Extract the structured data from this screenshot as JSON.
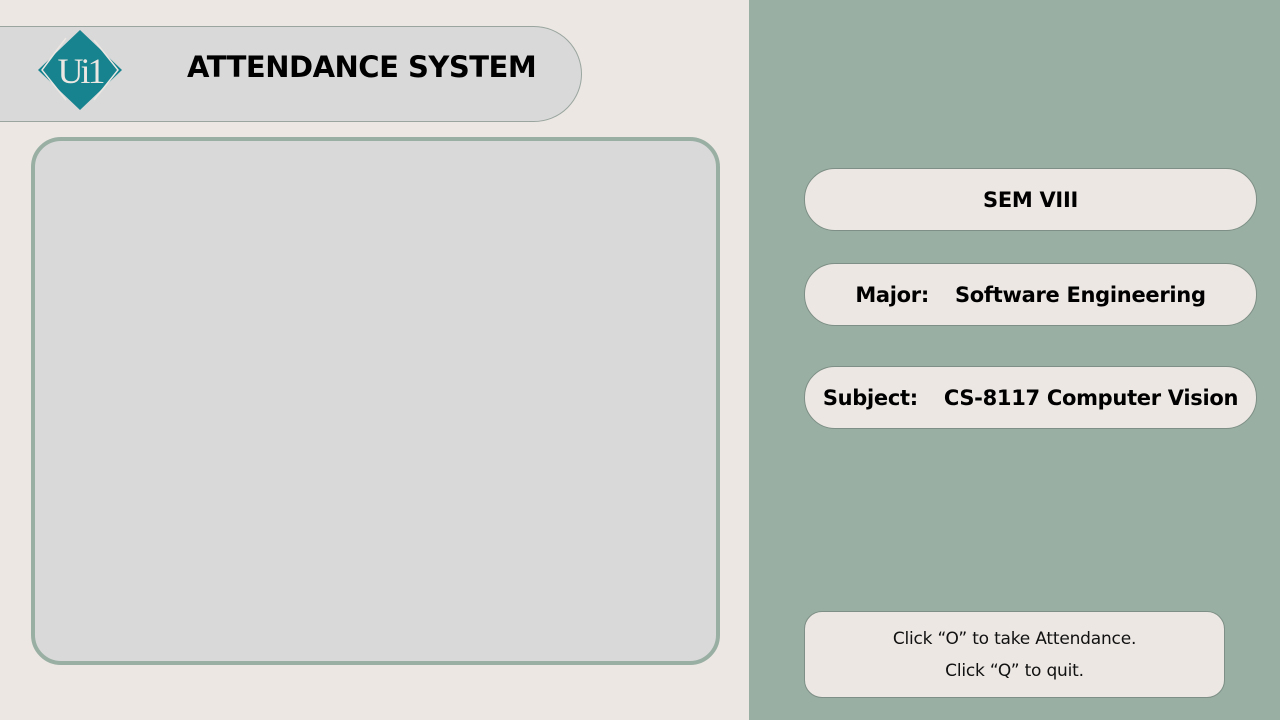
{
  "header": {
    "title": "ATTENDANCE SYSTEM",
    "logo_text": "Ui1",
    "logo_icon": "diamond-logo"
  },
  "info": {
    "semester": "SEM VIII",
    "major_label": "Major:",
    "major_value": "Software Engineering",
    "subject_label": "Subject:",
    "subject_value": "CS-8117 Computer Vision"
  },
  "instructions": {
    "line1": "Click “O” to take Attendance.",
    "line2": "Click “Q” to quit."
  },
  "colors": {
    "background": "#ece7e3",
    "side_panel": "#9aafa4",
    "frame": "#d9d9d9",
    "logo": "#16838e"
  }
}
